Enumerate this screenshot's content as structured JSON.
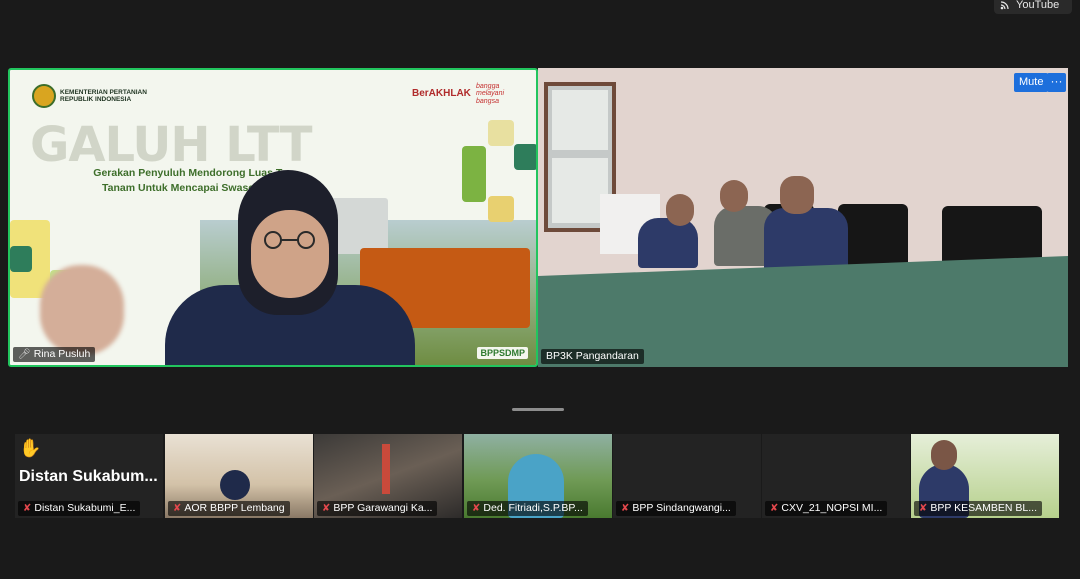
{
  "youtube_badge": {
    "label": "YouTube",
    "icon": "live-stream-icon"
  },
  "main_tiles": [
    {
      "participant": "Rina Pusluh",
      "slide": {
        "ministry_line1": "KEMENTERIAN PERTANIAN",
        "ministry_line2": "REPUBLIK INDONESIA",
        "berakhlak": "BerAKHLAK",
        "bangga_line1": "bangga",
        "bangga_line2": "melayani",
        "bangga_line3": "bangsa",
        "title": "GALUH LTT",
        "subtitle_line1": "Gerakan Penyuluh Mendorong Luas Tam",
        "subtitle_line2": "Tanam Untuk Mencapai Swasembada",
        "footer_logo": "BPPSDMP"
      }
    },
    {
      "participant": "BP3K Pangandaran"
    }
  ],
  "controls": {
    "mute": "Mute",
    "more": "···"
  },
  "filmstrip": [
    {
      "name": "Distan Sukabumi_E...",
      "big_label": "Distan  Sukabum...",
      "hand_raised": true
    },
    {
      "name": "AOR BBPP Lembang",
      "hand_raised": false
    },
    {
      "name": "BPP Garawangi Ka...",
      "hand_raised": false
    },
    {
      "name": "Ded. Fitriadi,S.P.BP...",
      "hand_raised": false
    },
    {
      "name": "BPP Sindangwangi...",
      "hand_raised": false
    },
    {
      "name": "CXV_21_NOPSI MI...",
      "hand_raised": false
    },
    {
      "name": "BPP KESAMBEN BL...",
      "hand_raised": false
    }
  ],
  "colors": {
    "active_speaker_border": "#22c55e",
    "button_blue": "#1d6fdc",
    "muted_mic": "#e5484d"
  }
}
